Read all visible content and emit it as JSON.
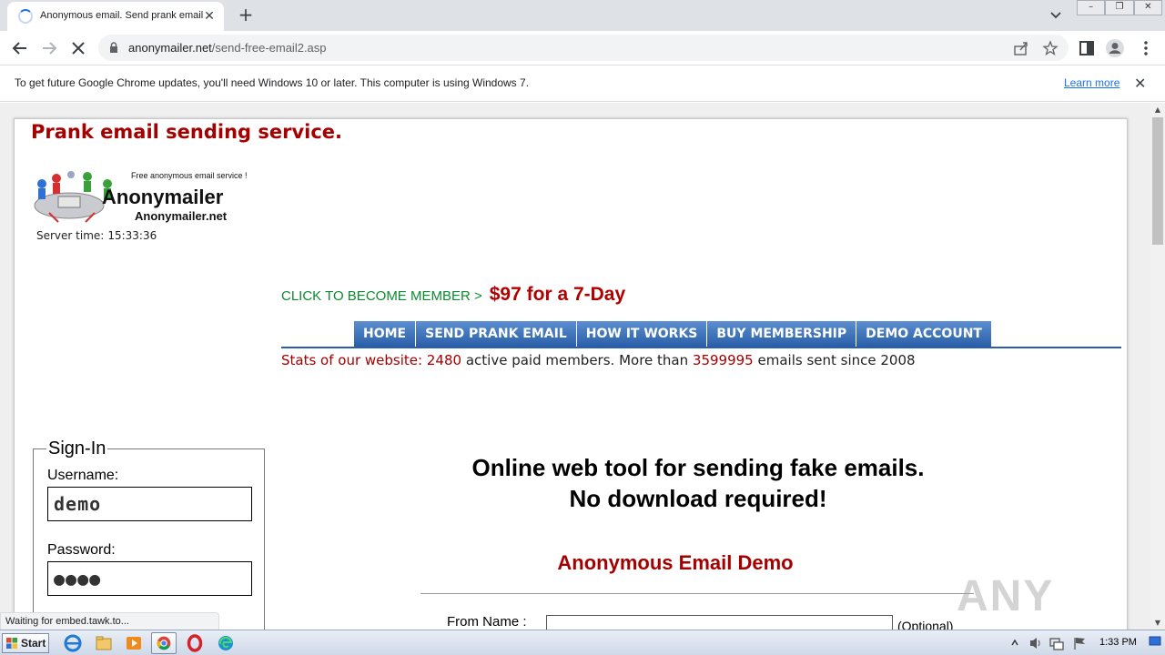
{
  "browser": {
    "tab_title": "Anonymous email. Send prank email.",
    "tab_close": "✕",
    "new_tab": "+",
    "url_host": "anonymailer.net",
    "url_path": "/send-free-email2.asp",
    "window_controls": [
      "–",
      "❐",
      "✕"
    ]
  },
  "infobar": {
    "message": "To get future Google Chrome updates, you'll need Windows 10 or later. This computer is using Windows 7.",
    "link": "Learn more",
    "close": "✕"
  },
  "page": {
    "brand_title": "Prank email sending service.",
    "logo": {
      "tagline": "Free anonymous email service !",
      "name": "Anonymailer",
      "domain": "Anonymailer.net"
    },
    "server_time_label": "Server time:",
    "server_time": "15:33:36",
    "cta_link": "CLICK TO BECOME MEMBER >",
    "cta_price": "$97 for a 7-Day",
    "nav": [
      "HOME",
      "SEND PRANK EMAIL",
      "HOW IT WORKS",
      "BUY MEMBERSHIP",
      "DEMO ACCOUNT"
    ],
    "stats": {
      "label": "Stats of our website:",
      "members": "2480",
      "members_text": "active paid members. More than",
      "emails": "3599995",
      "emails_text": "emails sent since 2008"
    },
    "signin": {
      "legend": "Sign-In",
      "username_label": "Username:",
      "username_value": "demo",
      "password_label": "Password:",
      "password_value": "●●●●"
    },
    "headline_1": "Online web tool for sending fake emails.",
    "headline_2": "No download required!",
    "demo_title": "Anonymous Email Demo",
    "from_label": "From Name :",
    "from_optional": "(Optional)",
    "watermark": "ANY RUN"
  },
  "status": "Waiting for embed.tawk.to...",
  "taskbar": {
    "start": "Start",
    "clock": "1:33 PM"
  },
  "colors": {
    "brand_red": "#a50000",
    "cta_green": "#0b8a30",
    "nav_blue": "#2a5ea8"
  }
}
